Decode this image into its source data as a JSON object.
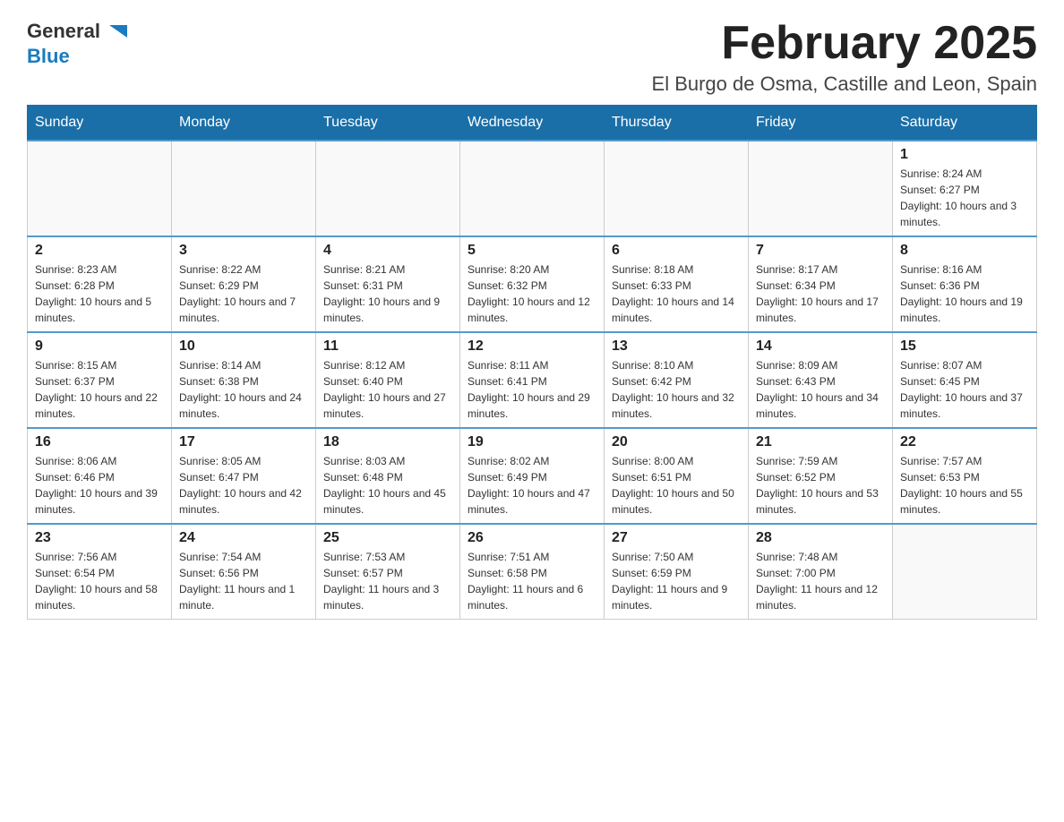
{
  "logo": {
    "text_general": "General",
    "text_blue": "Blue"
  },
  "title": {
    "month": "February 2025",
    "location": "El Burgo de Osma, Castille and Leon, Spain"
  },
  "weekdays": [
    "Sunday",
    "Monday",
    "Tuesday",
    "Wednesday",
    "Thursday",
    "Friday",
    "Saturday"
  ],
  "weeks": [
    [
      {
        "day": "",
        "info": ""
      },
      {
        "day": "",
        "info": ""
      },
      {
        "day": "",
        "info": ""
      },
      {
        "day": "",
        "info": ""
      },
      {
        "day": "",
        "info": ""
      },
      {
        "day": "",
        "info": ""
      },
      {
        "day": "1",
        "info": "Sunrise: 8:24 AM\nSunset: 6:27 PM\nDaylight: 10 hours and 3 minutes."
      }
    ],
    [
      {
        "day": "2",
        "info": "Sunrise: 8:23 AM\nSunset: 6:28 PM\nDaylight: 10 hours and 5 minutes."
      },
      {
        "day": "3",
        "info": "Sunrise: 8:22 AM\nSunset: 6:29 PM\nDaylight: 10 hours and 7 minutes."
      },
      {
        "day": "4",
        "info": "Sunrise: 8:21 AM\nSunset: 6:31 PM\nDaylight: 10 hours and 9 minutes."
      },
      {
        "day": "5",
        "info": "Sunrise: 8:20 AM\nSunset: 6:32 PM\nDaylight: 10 hours and 12 minutes."
      },
      {
        "day": "6",
        "info": "Sunrise: 8:18 AM\nSunset: 6:33 PM\nDaylight: 10 hours and 14 minutes."
      },
      {
        "day": "7",
        "info": "Sunrise: 8:17 AM\nSunset: 6:34 PM\nDaylight: 10 hours and 17 minutes."
      },
      {
        "day": "8",
        "info": "Sunrise: 8:16 AM\nSunset: 6:36 PM\nDaylight: 10 hours and 19 minutes."
      }
    ],
    [
      {
        "day": "9",
        "info": "Sunrise: 8:15 AM\nSunset: 6:37 PM\nDaylight: 10 hours and 22 minutes."
      },
      {
        "day": "10",
        "info": "Sunrise: 8:14 AM\nSunset: 6:38 PM\nDaylight: 10 hours and 24 minutes."
      },
      {
        "day": "11",
        "info": "Sunrise: 8:12 AM\nSunset: 6:40 PM\nDaylight: 10 hours and 27 minutes."
      },
      {
        "day": "12",
        "info": "Sunrise: 8:11 AM\nSunset: 6:41 PM\nDaylight: 10 hours and 29 minutes."
      },
      {
        "day": "13",
        "info": "Sunrise: 8:10 AM\nSunset: 6:42 PM\nDaylight: 10 hours and 32 minutes."
      },
      {
        "day": "14",
        "info": "Sunrise: 8:09 AM\nSunset: 6:43 PM\nDaylight: 10 hours and 34 minutes."
      },
      {
        "day": "15",
        "info": "Sunrise: 8:07 AM\nSunset: 6:45 PM\nDaylight: 10 hours and 37 minutes."
      }
    ],
    [
      {
        "day": "16",
        "info": "Sunrise: 8:06 AM\nSunset: 6:46 PM\nDaylight: 10 hours and 39 minutes."
      },
      {
        "day": "17",
        "info": "Sunrise: 8:05 AM\nSunset: 6:47 PM\nDaylight: 10 hours and 42 minutes."
      },
      {
        "day": "18",
        "info": "Sunrise: 8:03 AM\nSunset: 6:48 PM\nDaylight: 10 hours and 45 minutes."
      },
      {
        "day": "19",
        "info": "Sunrise: 8:02 AM\nSunset: 6:49 PM\nDaylight: 10 hours and 47 minutes."
      },
      {
        "day": "20",
        "info": "Sunrise: 8:00 AM\nSunset: 6:51 PM\nDaylight: 10 hours and 50 minutes."
      },
      {
        "day": "21",
        "info": "Sunrise: 7:59 AM\nSunset: 6:52 PM\nDaylight: 10 hours and 53 minutes."
      },
      {
        "day": "22",
        "info": "Sunrise: 7:57 AM\nSunset: 6:53 PM\nDaylight: 10 hours and 55 minutes."
      }
    ],
    [
      {
        "day": "23",
        "info": "Sunrise: 7:56 AM\nSunset: 6:54 PM\nDaylight: 10 hours and 58 minutes."
      },
      {
        "day": "24",
        "info": "Sunrise: 7:54 AM\nSunset: 6:56 PM\nDaylight: 11 hours and 1 minute."
      },
      {
        "day": "25",
        "info": "Sunrise: 7:53 AM\nSunset: 6:57 PM\nDaylight: 11 hours and 3 minutes."
      },
      {
        "day": "26",
        "info": "Sunrise: 7:51 AM\nSunset: 6:58 PM\nDaylight: 11 hours and 6 minutes."
      },
      {
        "day": "27",
        "info": "Sunrise: 7:50 AM\nSunset: 6:59 PM\nDaylight: 11 hours and 9 minutes."
      },
      {
        "day": "28",
        "info": "Sunrise: 7:48 AM\nSunset: 7:00 PM\nDaylight: 11 hours and 12 minutes."
      },
      {
        "day": "",
        "info": ""
      }
    ]
  ]
}
